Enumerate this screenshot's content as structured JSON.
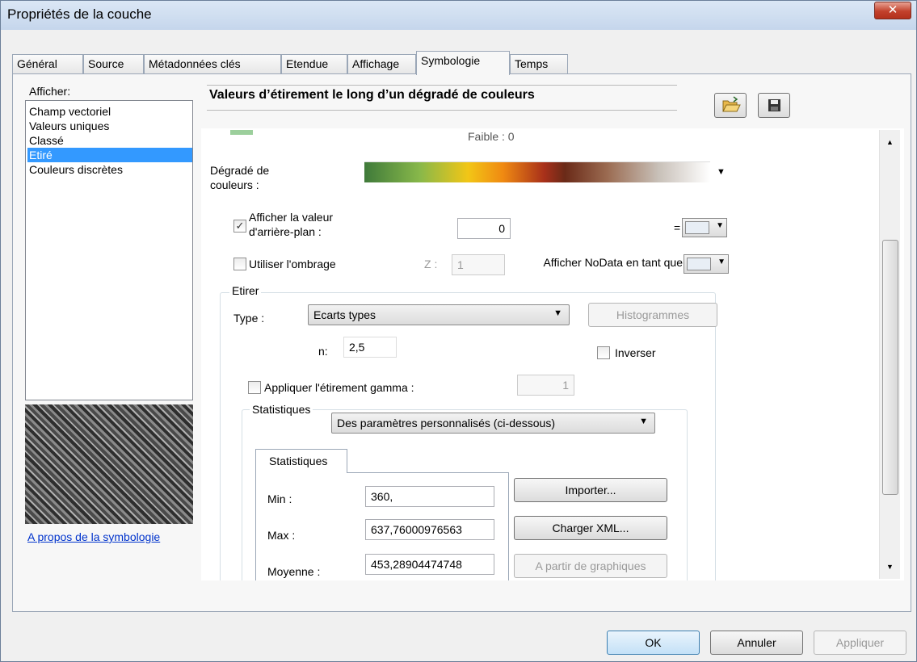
{
  "window": {
    "title": "Propriétés de la couche",
    "close_glyph": "✕"
  },
  "tabs": [
    {
      "label": "Général"
    },
    {
      "label": "Source"
    },
    {
      "label": "Métadonnées clés"
    },
    {
      "label": "Etendue"
    },
    {
      "label": "Affichage"
    },
    {
      "label": "Symbologie",
      "active": true
    },
    {
      "label": "Temps"
    }
  ],
  "sidebar": {
    "header": "Afficher:",
    "items": [
      {
        "label": "Champ vectoriel"
      },
      {
        "label": "Valeurs uniques"
      },
      {
        "label": "Classé"
      },
      {
        "label": "Etiré",
        "selected": true
      },
      {
        "label": "Couleurs discrètes"
      }
    ],
    "link": "A propos de la symbologie"
  },
  "symbology": {
    "title": "Valeurs d’étirement le long d’un dégradé de couleurs",
    "open_icon": "folder-open-icon",
    "save_icon": "save-icon"
  },
  "panel": {
    "faible_label": "Faible : 0",
    "gradient_label": "Dégradé de couleurs :",
    "background_checkbox_label": "Afficher la valeur d'arrière-plan :",
    "background_value": "0",
    "background_equals": "=",
    "shading_label": "Utiliser l'ombrage",
    "z_label": "Z :",
    "z_value": "1",
    "nodata_label": "Afficher NoData en tant que",
    "stretch_group": "Etirer",
    "type_label": "Type :",
    "type_value": "Ecarts types",
    "histograms_button": "Histogrammes",
    "n_label": "n:",
    "n_value": "2,5",
    "invert_label": "Inverser",
    "gamma_label": "Appliquer l'étirement gamma :",
    "gamma_value": "1",
    "stats_group": "Statistiques",
    "stats_mode": "Des paramètres personnalisés (ci-dessous)",
    "stats_tab": "Statistiques",
    "min_label": "Min :",
    "min_value": "360,",
    "max_label": "Max :",
    "max_value": "637,76000976563",
    "mean_label": "Moyenne :",
    "mean_value": "453,28904474748",
    "import_button": "Importer...",
    "load_xml_button": "Charger XML...",
    "from_graphics_button": "A partir de graphiques"
  },
  "footer": {
    "ok": "OK",
    "cancel": "Annuler",
    "apply": "Appliquer"
  }
}
